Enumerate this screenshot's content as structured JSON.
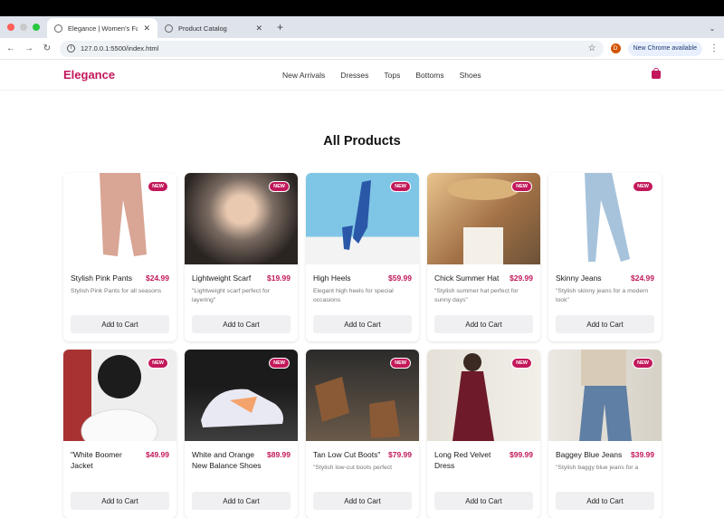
{
  "browser": {
    "tabs": [
      {
        "label": "Elegance | Women's Fashion",
        "active": true
      },
      {
        "label": "Product Catalog",
        "active": false
      }
    ],
    "url": "127.0.0.1:5500/index.html",
    "profile_initial": "D",
    "update_label": "New Chrome available"
  },
  "site": {
    "logo": "Elegance",
    "nav": [
      "New Arrivals",
      "Dresses",
      "Tops",
      "Bottoms",
      "Shoes"
    ],
    "heading": "All Products",
    "badge": "NEW",
    "cart_button": "Add to Cart"
  },
  "products": [
    {
      "name": "Stylish Pink Pants",
      "price": "$24.99",
      "desc": "Stylish Pink Pants for all seasons"
    },
    {
      "name": "Lightweight Scarf",
      "price": "$19.99",
      "desc": "\"Lightweight scarf perfect for layering\""
    },
    {
      "name": "High Heels",
      "price": "$59.99",
      "desc": "Elegant high heels for special occasions"
    },
    {
      "name": "Chick Summer Hat",
      "price": "$29.99",
      "desc": "\"Stylish summer hat perfect for sunny days\""
    },
    {
      "name": "Skinny Jeans",
      "price": "$24.99",
      "desc": "\"Stylish skinny jeans for a modern look\""
    },
    {
      "name": "\"White Boomer Jacket",
      "price": "$49.99",
      "desc": ""
    },
    {
      "name": "White and Orange New Balance Shoes",
      "price": "$89.99",
      "desc": ""
    },
    {
      "name": "Tan Low Cut Boots\"",
      "price": "$79.99",
      "desc": "\"Stylish low-cut boots perfect"
    },
    {
      "name": "Long Red Velvet Dress",
      "price": "$99.99",
      "desc": ""
    },
    {
      "name": "Baggey Blue Jeans",
      "price": "$39.99",
      "desc": "\"Stylish baggy blue jeans for a"
    }
  ],
  "colors": {
    "accent": "#c2185b"
  }
}
